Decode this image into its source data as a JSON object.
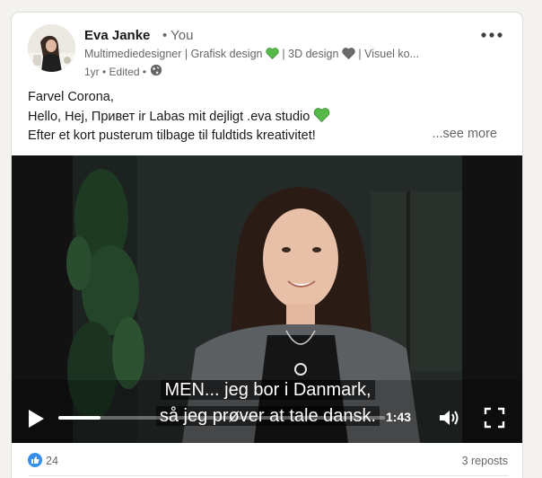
{
  "post": {
    "author": {
      "name": "Eva Janke",
      "badge": "• You",
      "headline_parts": [
        "Multimediedesigner | Grafisk design ",
        " | 3D design ",
        " | Visuel ko..."
      ],
      "meta_text": "1yr • Edited •",
      "visibility_icon": "globe-icon"
    },
    "text_lines": [
      "Farvel Corona,",
      "Hello, Hej, Привет ir Labas mit dejligt .eva studio",
      "Efter et kort pusterum tilbage til fuldtids kreativitet!"
    ],
    "see_more_label": "...see more",
    "more_menu_icon": "ellipsis-icon",
    "emoji": {
      "green_heart_color": "#57b94a",
      "grey_heart_color": "#6b6b6b"
    }
  },
  "video": {
    "subtitle_line1": "MEN... jeg bor i Danmark,",
    "subtitle_line2": "så jeg prøver at tale dansk.",
    "time_remaining": "1:43",
    "progress": 0.13,
    "controls": {
      "play_icon": "play-icon",
      "volume_icon": "volume-icon",
      "fullscreen_icon": "fullscreen-icon"
    }
  },
  "social": {
    "reaction_icon": "like-icon",
    "reaction_count": "24",
    "reposts_label": "3 reposts"
  },
  "colors": {
    "like_blue": "#378fe9",
    "muted_text": "#666666"
  }
}
